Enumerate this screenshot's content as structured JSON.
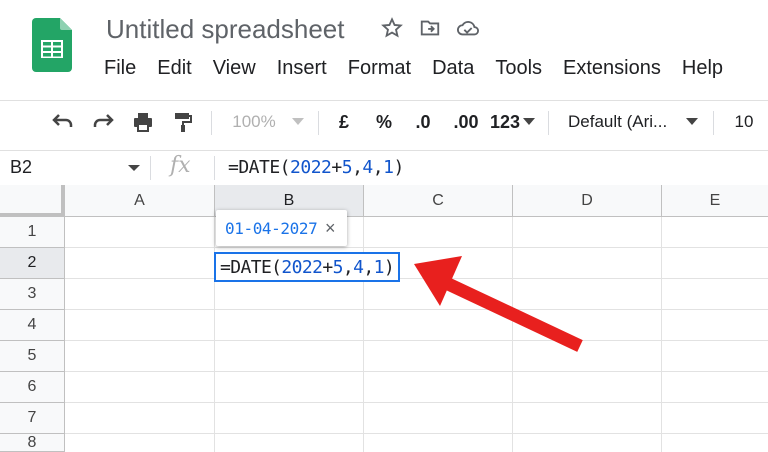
{
  "app": {
    "title": "Untitled spreadsheet",
    "menu": [
      "File",
      "Edit",
      "View",
      "Insert",
      "Format",
      "Data",
      "Tools",
      "Extensions",
      "Help"
    ]
  },
  "toolbar": {
    "zoom": "100%",
    "currency": "£",
    "percent": "%",
    "dec_decrease": ".0",
    "dec_increase": ".00",
    "format_more": "123",
    "font": "Default (Ari...",
    "font_size": "10"
  },
  "formula_bar": {
    "name_box": "B2",
    "fx": "fx",
    "formula_prefix": "=DATE(",
    "arg1": "2022",
    "plus": "+",
    "arg2": "5",
    "comma1": ",",
    "arg3": "4",
    "comma2": ",",
    "arg4": "1",
    "suffix": ")"
  },
  "grid": {
    "columns": [
      "A",
      "B",
      "C",
      "D",
      "E"
    ],
    "rows": [
      "1",
      "2",
      "3",
      "4",
      "5",
      "6",
      "7",
      "8"
    ],
    "selected_column": "B",
    "selected_row": "2"
  },
  "tooltip": {
    "value": "01-04-2027",
    "close": "×"
  },
  "cell_editor": {
    "prefix": "=DATE(",
    "arg1": "2022",
    "plus": "+",
    "arg2": "5",
    "comma1": ",",
    "arg3": "4",
    "comma2": ",",
    "arg4": "1",
    "suffix": ")"
  },
  "colors": {
    "accent": "#1a73e8",
    "number": "#1155cc",
    "annotation_arrow": "#e8201e"
  }
}
